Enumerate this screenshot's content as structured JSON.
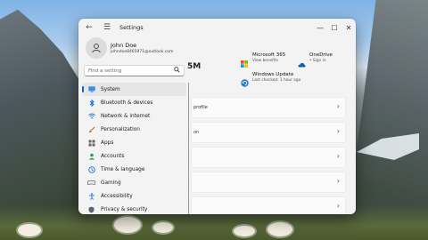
{
  "window": {
    "title": "Settings",
    "back_glyph": "←",
    "menu_glyph": "☰",
    "minimize_glyph": "—",
    "maximize_glyph": "☐",
    "close_glyph": "✕"
  },
  "user": {
    "name": "John Doe",
    "email": "johndoe8465971@outlook.com"
  },
  "search": {
    "placeholder": "Find a setting",
    "icon": "search-icon"
  },
  "nav": [
    {
      "label": "System",
      "icon": "monitor-icon",
      "color": "#0067c0",
      "selected": true
    },
    {
      "label": "Bluetooth & devices",
      "icon": "bluetooth-icon",
      "color": "#0a6cd6"
    },
    {
      "label": "Network & internet",
      "icon": "wifi-icon",
      "color": "#2277cc"
    },
    {
      "label": "Personalization",
      "icon": "brush-icon",
      "color": "#c66a2b"
    },
    {
      "label": "Apps",
      "icon": "apps-icon",
      "color": "#555555"
    },
    {
      "label": "Accounts",
      "icon": "person-icon",
      "color": "#2a9d5a"
    },
    {
      "label": "Time & language",
      "icon": "globe-clock-icon",
      "color": "#1a73c9"
    },
    {
      "label": "Gaming",
      "icon": "controller-icon",
      "color": "#666666"
    },
    {
      "label": "Accessibility",
      "icon": "accessibility-icon",
      "color": "#2c7be5"
    },
    {
      "label": "Privacy & security",
      "icon": "shield-icon",
      "color": "#5a6470"
    }
  ],
  "main": {
    "partial_heading": "5M",
    "tiles": [
      {
        "title": "Microsoft 365",
        "subtitle": "View benefits",
        "icon": "microsoft-logo-icon"
      },
      {
        "title": "OneDrive",
        "subtitle": "• Sign in",
        "icon": "cloud-icon"
      },
      {
        "title": "Windows Update",
        "subtitle": "Last checked: 1 hour ago",
        "icon": "update-icon"
      }
    ],
    "cards": [
      {
        "text": "profile"
      },
      {
        "text": "on"
      },
      {
        "text": ""
      },
      {
        "text": ""
      },
      {
        "text": ""
      }
    ],
    "chevron": "›"
  }
}
